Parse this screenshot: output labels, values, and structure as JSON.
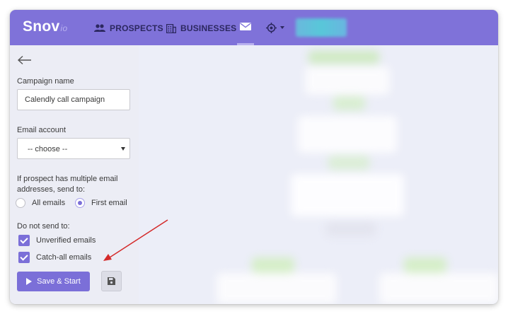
{
  "app": {
    "logo_main": "Snov",
    "logo_suffix": "io"
  },
  "nav": {
    "prospects": "PROSPECTS",
    "businesses": "BUSINESSES"
  },
  "sidebar": {
    "campaign_name_label": "Campaign name",
    "campaign_name_value": "Calendly call campaign",
    "email_account_label": "Email account",
    "email_account_value": "-- choose --",
    "multiple_line1": "If prospect has multiple email",
    "multiple_line2": "addresses, send to:",
    "radio_all": "All emails",
    "radio_first": "First email",
    "do_not_send_label": "Do not send to:",
    "unverified": "Unverified emails",
    "catch_all": "Catch-all emails",
    "save_start": "Save & Start"
  },
  "colors": {
    "navbar": "#7f72d9",
    "accent": "#7b6fd8",
    "annotation_arrow": "#d42a2a"
  }
}
